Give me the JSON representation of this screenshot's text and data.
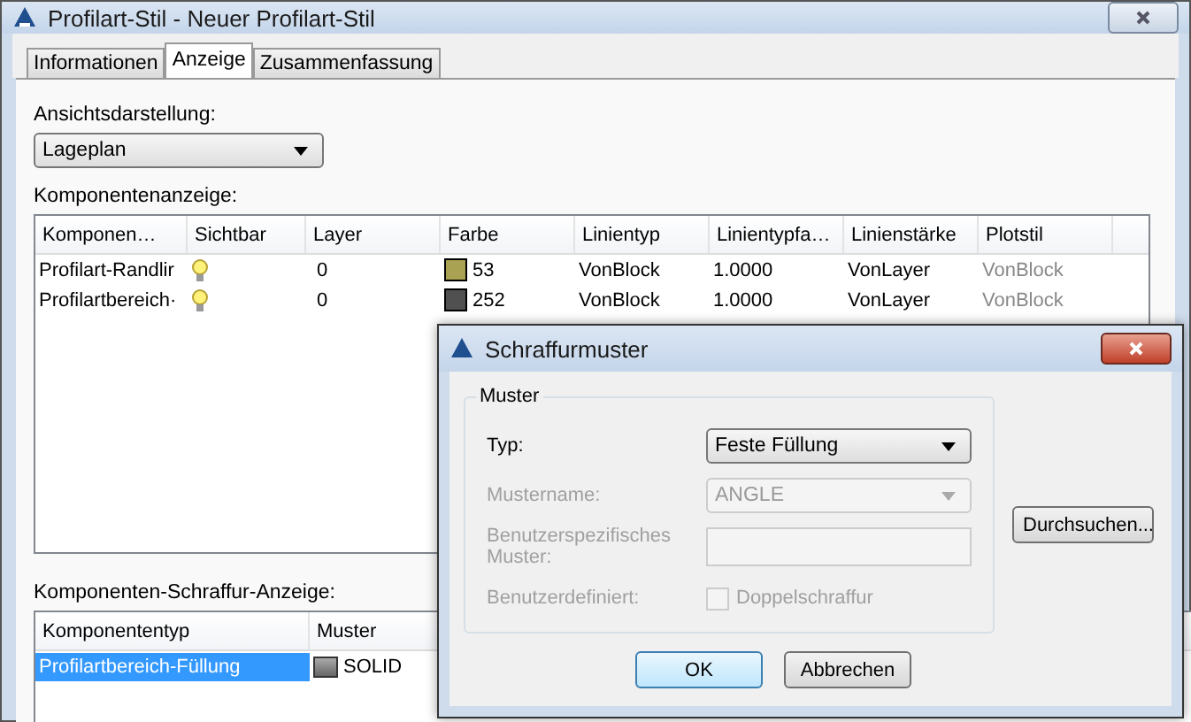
{
  "window": {
    "title": "Profilart-Stil - Neuer Profilart-Stil"
  },
  "tabs": [
    {
      "label": "Informationen",
      "selected": false
    },
    {
      "label": "Anzeige",
      "selected": true
    },
    {
      "label": "Zusammenfassung",
      "selected": false
    }
  ],
  "view": {
    "label": "Ansichtsdarstellung:",
    "value": "Lageplan"
  },
  "components": {
    "label": "Komponentenanzeige:",
    "columns": [
      "Komponen…",
      "Sichtbar",
      "Layer",
      "Farbe",
      "Linientyp",
      "Linientypfa…",
      "Linienstärke",
      "Plotstil"
    ],
    "rows": [
      {
        "name": "Profilart-Randlir",
        "visible": true,
        "layer": "0",
        "color": "#a9a252",
        "color_label": "53",
        "linetype": "VonBlock",
        "scale": "1.0000",
        "weight": "VonLayer",
        "plotstyle": "VonBlock"
      },
      {
        "name": "Profilartbereich·",
        "visible": true,
        "layer": "0",
        "color": "#505050",
        "color_label": "252",
        "linetype": "VonBlock",
        "scale": "1.0000",
        "weight": "VonLayer",
        "plotstyle": "VonBlock"
      }
    ]
  },
  "hatch": {
    "label": "Komponenten-Schraffur-Anzeige:",
    "columns": [
      "Komponententyp",
      "Muster"
    ],
    "rows": [
      {
        "type": "Profilartbereich-Füllung",
        "pattern": "SOLID",
        "selected": true
      }
    ]
  },
  "dialog": {
    "title": "Schraffurmuster",
    "group": "Muster",
    "type": {
      "label": "Typ:",
      "value": "Feste Füllung",
      "disabled": false
    },
    "pattern_name": {
      "label": "Mustername:",
      "value": "ANGLE",
      "disabled": true
    },
    "custom": {
      "label": "Benutzerspezifisches Muster:",
      "disabled": true
    },
    "user_defined": {
      "label": "Benutzerdefiniert:",
      "option": "Doppelschraffur",
      "checked": false,
      "disabled": true
    },
    "browse": "Durchsuchen...",
    "ok": "OK",
    "cancel": "Abbrechen"
  }
}
